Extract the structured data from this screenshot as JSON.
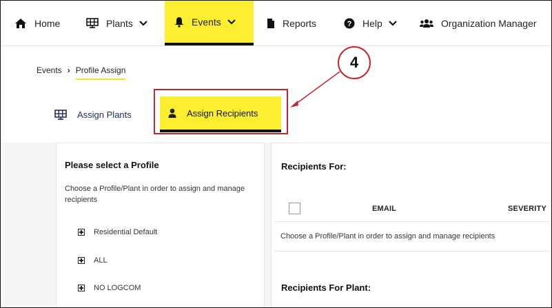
{
  "nav": {
    "home": "Home",
    "plants": "Plants",
    "events": "Events",
    "reports": "Reports",
    "help": "Help",
    "organization_manager": "Organization Manager"
  },
  "breadcrumb": {
    "root": "Events",
    "current": "Profile Assign"
  },
  "tabs": {
    "assign_plants": "Assign Plants",
    "assign_recipients": "Assign Recipients"
  },
  "callout": {
    "number": "4"
  },
  "profile_panel": {
    "title": "Please select a Profile",
    "description": "Choose a Profile/Plant in order to assign and manage recipients",
    "items": [
      "Residential Default",
      "ALL",
      "NO LOGCOM"
    ]
  },
  "recipients_panel": {
    "title": "Recipients For:",
    "columns": {
      "email": "EMAIL",
      "severity": "SEVERITY"
    },
    "empty_message": "Choose a Profile/Plant in order to assign and manage recipients",
    "plant_title": "Recipients For Plant:"
  },
  "colors": {
    "accent_yellow": "#fbee2e",
    "callout_red": "#c0262d",
    "tab_text": "#1f2b57"
  }
}
